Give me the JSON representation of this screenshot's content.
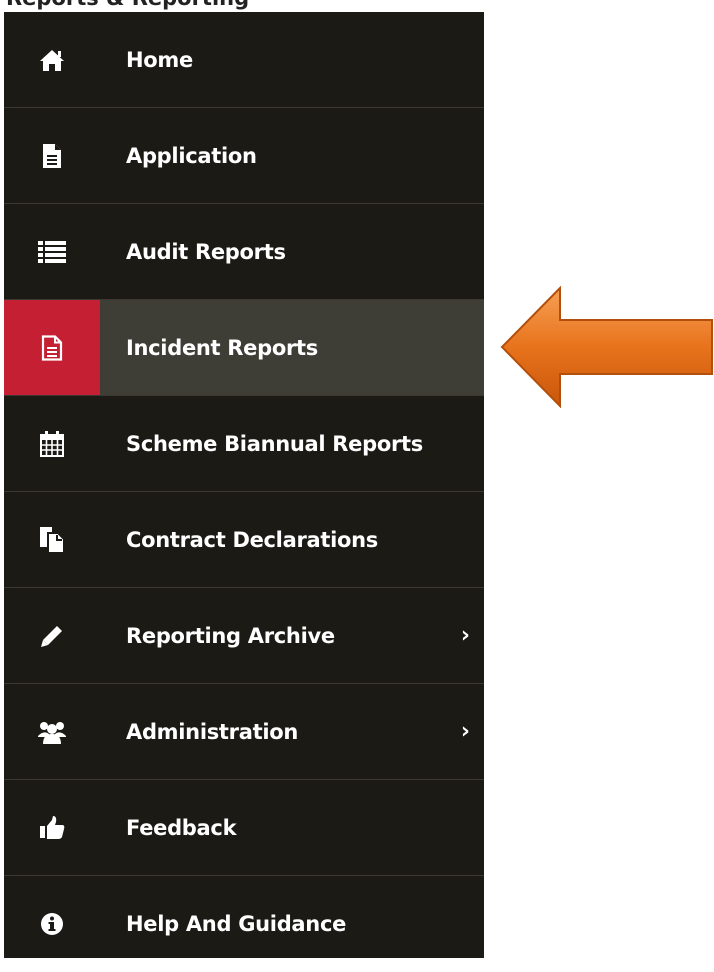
{
  "page": {
    "header_text": "Reports & Reporting"
  },
  "sidebar": {
    "items": [
      {
        "label": "Home",
        "icon": "home-icon"
      },
      {
        "label": "Application",
        "icon": "document-icon"
      },
      {
        "label": "Audit Reports",
        "icon": "list-icon"
      },
      {
        "label": "Incident Reports",
        "icon": "document-outline-icon",
        "active": true
      },
      {
        "label": "Scheme Biannual Reports",
        "icon": "calendar-icon"
      },
      {
        "label": "Contract Declarations",
        "icon": "copy-icon"
      },
      {
        "label": "Reporting Archive",
        "icon": "pencil-icon",
        "chevron": "›"
      },
      {
        "label": "Administration",
        "icon": "users-icon",
        "chevron": "›"
      },
      {
        "label": "Feedback",
        "icon": "thumbs-up-icon"
      },
      {
        "label": "Help And Guidance",
        "icon": "info-icon"
      }
    ]
  },
  "colors": {
    "sidebar_bg": "#1b1a15",
    "active_row_bg": "#3f3e36",
    "active_icon_bg": "#c51f33",
    "arrow": "#e8731c"
  }
}
